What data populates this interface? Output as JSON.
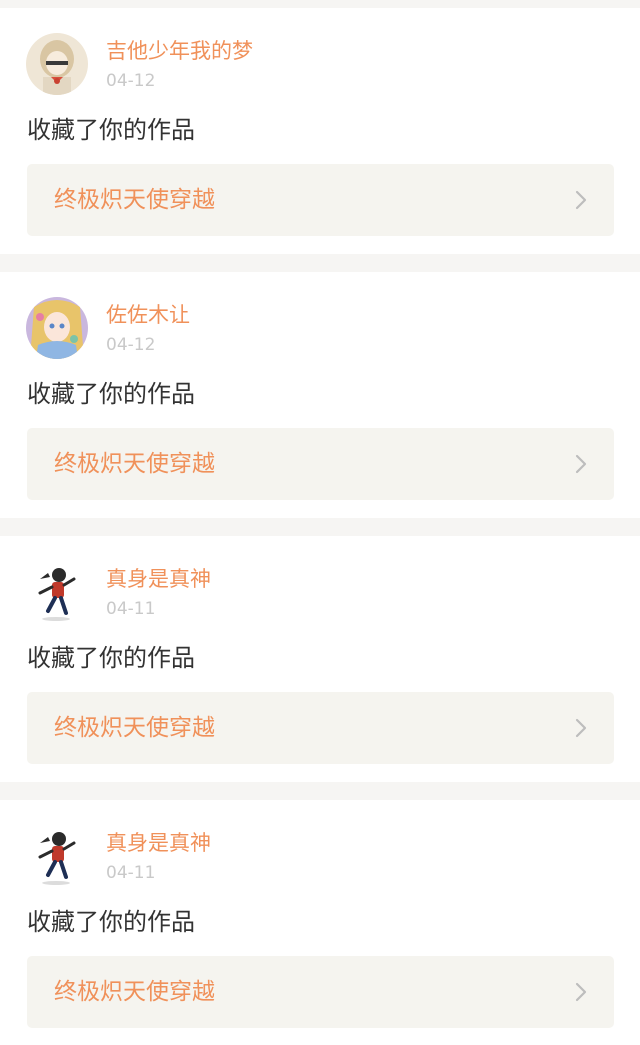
{
  "notifications": [
    {
      "username": "吉他少年我的梦",
      "date": "04-12",
      "action": "收藏了你的作品",
      "work_title": "终极炽天使穿越",
      "avatar_icon": "girl-avatar-icon"
    },
    {
      "username": "佐佐木让",
      "date": "04-12",
      "action": "收藏了你的作品",
      "work_title": "终极炽天使穿越",
      "avatar_icon": "anime-girl-avatar-icon"
    },
    {
      "username": "真身是真神",
      "date": "04-11",
      "action": "收藏了你的作品",
      "work_title": "终极炽天使穿越",
      "avatar_icon": "running-figure-avatar-icon"
    },
    {
      "username": "真身是真神",
      "date": "04-11",
      "action": "收藏了你的作品",
      "work_title": "终极炽天使穿越",
      "avatar_icon": "running-figure-avatar-icon"
    }
  ],
  "colors": {
    "accent": "#f0915a",
    "date_text": "#c9c9c9",
    "body_text": "#333333",
    "page_bg": "#f6f5f3",
    "link_bg": "#f5f4ef"
  }
}
